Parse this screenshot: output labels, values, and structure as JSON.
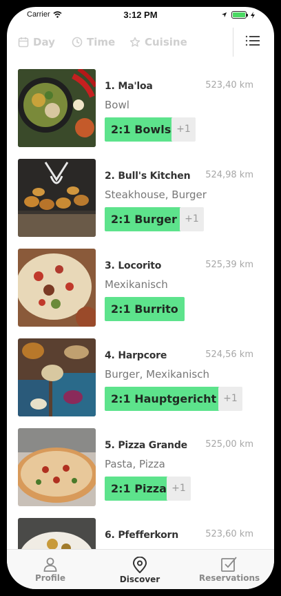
{
  "status_bar": {
    "carrier": "Carrier",
    "time": "3:12 PM"
  },
  "filters": {
    "day": "Day",
    "time": "Time",
    "cuisine": "Cuisine"
  },
  "restaurants": [
    {
      "name": "1. Ma'loa",
      "distance": "523,40 km",
      "category": "Bowl",
      "deal": "2:1 Bowls",
      "more": "+1"
    },
    {
      "name": "2. Bull's Kitchen",
      "distance": "524,98 km",
      "category": "Steakhouse, Burger",
      "deal": "2:1 Burger",
      "more": "+1"
    },
    {
      "name": "3. Locorito",
      "distance": "525,39 km",
      "category": "Mexikanisch",
      "deal": "2:1 Burrito",
      "more": ""
    },
    {
      "name": "4. Harpcore",
      "distance": "524,56 km",
      "category": "Burger, Mexikanisch",
      "deal": "2:1 Hauptgericht",
      "more": "+1"
    },
    {
      "name": "5. Pizza Grande",
      "distance": "525,00 km",
      "category": "Pasta, Pizza",
      "deal": "2:1 Pizza",
      "more": "+1"
    },
    {
      "name": "6. Pfefferkorn",
      "distance": "523,60 km",
      "category": "",
      "deal": "",
      "more": ""
    }
  ],
  "tabs": {
    "profile": "Profile",
    "discover": "Discover",
    "reservations": "Reservations"
  },
  "colors": {
    "deal_green": "#5de38c",
    "active_tab": "#333333",
    "inactive": "#8a8a8a"
  }
}
